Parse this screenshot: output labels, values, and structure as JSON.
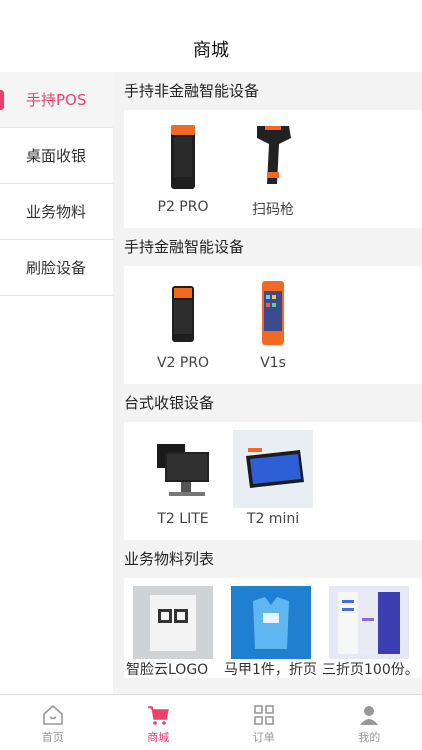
{
  "header": {
    "title": "商城"
  },
  "sidebar": {
    "items": [
      {
        "label": "手持POS",
        "active": true
      },
      {
        "label": "桌面收银",
        "active": false
      },
      {
        "label": "业务物料",
        "active": false
      },
      {
        "label": "刷脸设备",
        "active": false
      }
    ]
  },
  "sections": [
    {
      "title": "手持非金融智能设备",
      "products": [
        {
          "name": "P2 PRO",
          "icon": "handheld-pos-icon"
        },
        {
          "name": "扫码枪",
          "icon": "barcode-scanner-icon"
        }
      ]
    },
    {
      "title": "手持金融智能设备",
      "products": [
        {
          "name": "V2 PRO",
          "icon": "handheld-pos-icon"
        },
        {
          "name": "V1s",
          "icon": "handheld-pos-icon"
        }
      ]
    },
    {
      "title": "台式收银设备",
      "products": [
        {
          "name": "T2 LITE",
          "icon": "desktop-register-icon"
        },
        {
          "name": "T2 mini",
          "icon": "tablet-register-icon"
        }
      ]
    },
    {
      "title": "业务物料列表",
      "products": [
        {
          "name": "智脸云LOGO",
          "icon": "qr-sign-icon"
        },
        {
          "name": "马甲1件，折页",
          "icon": "vest-icon"
        },
        {
          "name": "三折页100份。",
          "icon": "brochure-icon"
        }
      ]
    }
  ],
  "tabbar": {
    "items": [
      {
        "label": "首页",
        "icon": "home-icon",
        "active": false
      },
      {
        "label": "商城",
        "icon": "cart-icon",
        "active": true
      },
      {
        "label": "订单",
        "icon": "grid-icon",
        "active": false
      },
      {
        "label": "我的",
        "icon": "user-icon",
        "active": false
      }
    ]
  },
  "colors": {
    "accent": "#ee3f6c",
    "orange": "#f26a22",
    "device": "#1e1e1e"
  }
}
